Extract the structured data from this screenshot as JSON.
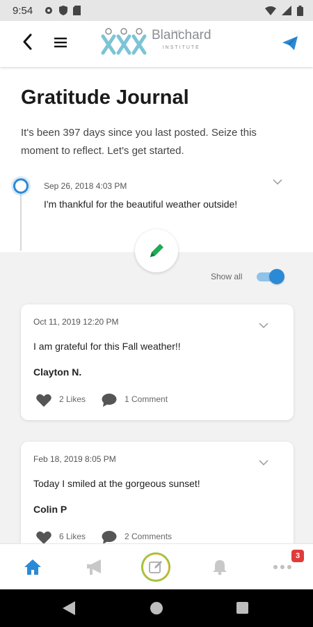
{
  "status_bar": {
    "time": "9:54",
    "icons": [
      "gear-icon",
      "shield-icon",
      "sd-card-icon",
      "wifi-icon",
      "signal-icon",
      "battery-icon"
    ]
  },
  "header": {
    "logo_the": "THE",
    "logo_name": "Blanchard",
    "logo_institute": "INSTITUTE",
    "accent_color": "#2b8ad6"
  },
  "journal": {
    "title": "Gratitude Journal",
    "subtitle": "It's been 397 days since you last posted. Seize this moment to reflect. Let's get started.",
    "own_entry": {
      "date": "Sep 26, 2018 4:03 PM",
      "text": "I'm thankful for the beautiful weather outside!"
    },
    "show_all_label": "Show all",
    "show_all_on": true
  },
  "posts": [
    {
      "date": "Oct 11, 2019 12:20 PM",
      "text": "I am grateful for this Fall weather!!",
      "author": "Clayton N.",
      "likes": "2 Likes",
      "comments": "1 Comment"
    },
    {
      "date": "Feb 18, 2019 8:05 PM",
      "text": "Today I smiled at the gorgeous sunset!",
      "author": "Colin P",
      "likes": "6 Likes",
      "comments": "2 Comments"
    }
  ],
  "bottom_nav": {
    "items": [
      "home-icon",
      "megaphone-icon",
      "journal-edit-icon",
      "bell-icon",
      "more-icon"
    ],
    "badge": "3"
  }
}
